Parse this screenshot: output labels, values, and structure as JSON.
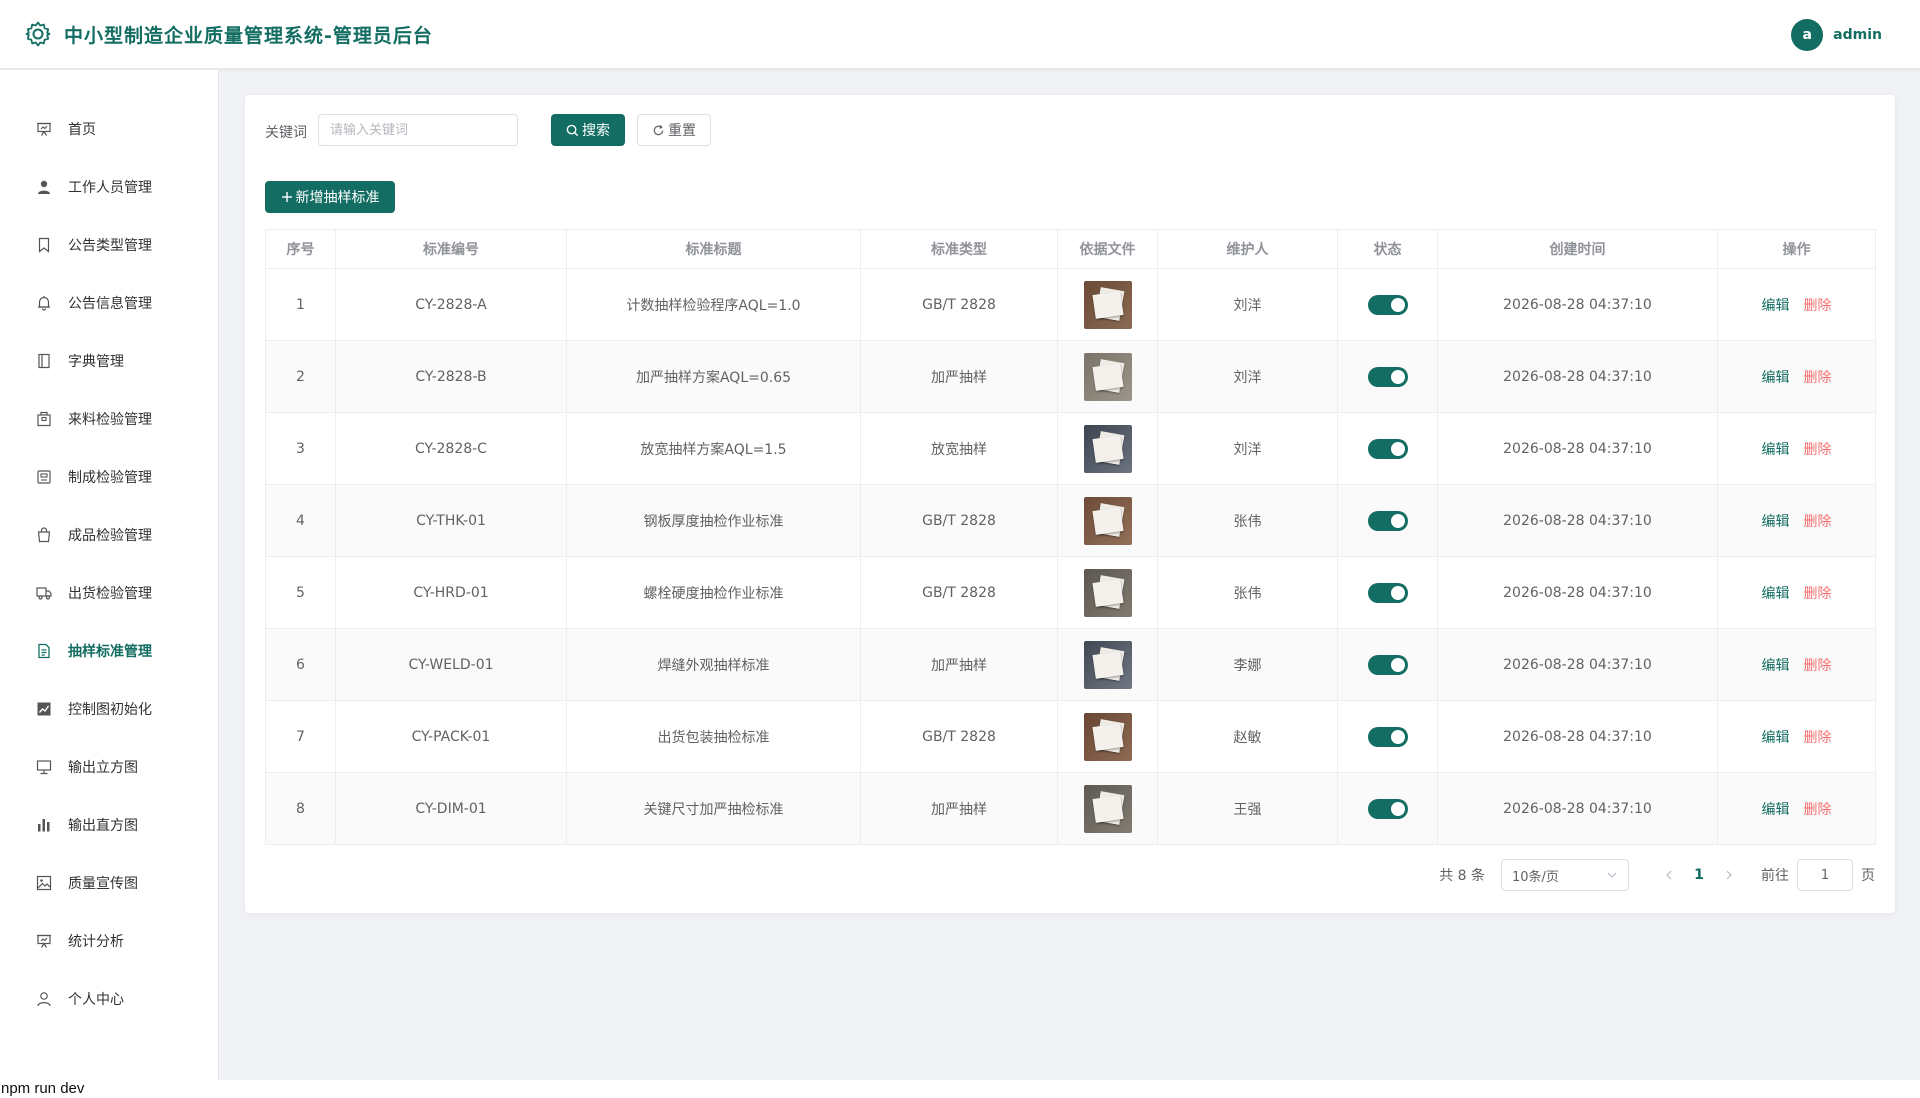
{
  "header": {
    "title": "中小型制造企业质量管理系统-管理员后台",
    "avatar_letter": "a",
    "username": "admin"
  },
  "sidebar": {
    "active": "抽样标准管理",
    "items": [
      {
        "label": "首页",
        "icon": "presentation-icon"
      },
      {
        "label": "工作人员管理",
        "icon": "user-filled-icon"
      },
      {
        "label": "公告类型管理",
        "icon": "bookmark-icon"
      },
      {
        "label": "公告信息管理",
        "icon": "bell-icon"
      },
      {
        "label": "字典管理",
        "icon": "notebook-icon"
      },
      {
        "label": "来料检验管理",
        "icon": "box-icon"
      },
      {
        "label": "制成检验管理",
        "icon": "suitcase-icon"
      },
      {
        "label": "成品检验管理",
        "icon": "handbag-icon"
      },
      {
        "label": "出货检验管理",
        "icon": "truck-icon"
      },
      {
        "label": "抽样标准管理",
        "icon": "document-icon"
      },
      {
        "label": "控制图初始化",
        "icon": "line-chart-icon"
      },
      {
        "label": "输出立方图",
        "icon": "monitor-icon"
      },
      {
        "label": "输出直方图",
        "icon": "bar-chart-icon"
      },
      {
        "label": "质量宣传图",
        "icon": "picture-icon"
      },
      {
        "label": "统计分析",
        "icon": "presentation-icon"
      },
      {
        "label": "个人中心",
        "icon": "user-icon"
      }
    ]
  },
  "search": {
    "label": "关键词",
    "placeholder": "请输入关键词",
    "value": "",
    "search_btn": "搜索",
    "reset_btn": "重置",
    "add_btn": "新增抽样标准"
  },
  "table": {
    "headers": [
      "序号",
      "标准编号",
      "标准标题",
      "标准类型",
      "依据文件",
      "维护人",
      "状态",
      "创建时间",
      "操作"
    ],
    "edit_label": "编辑",
    "delete_label": "删除",
    "rows": [
      {
        "no": "1",
        "code": "CY-2828-A",
        "title": "计数抽样检验程序AQL=1.0",
        "type": "GB/T 2828",
        "maintainer": "刘洋",
        "status": true,
        "created": "2026-08-28 04:37:10"
      },
      {
        "no": "2",
        "code": "CY-2828-B",
        "title": "加严抽样方案AQL=0.65",
        "type": "加严抽样",
        "maintainer": "刘洋",
        "status": true,
        "created": "2026-08-28 04:37:10"
      },
      {
        "no": "3",
        "code": "CY-2828-C",
        "title": "放宽抽样方案AQL=1.5",
        "type": "放宽抽样",
        "maintainer": "刘洋",
        "status": true,
        "created": "2026-08-28 04:37:10"
      },
      {
        "no": "4",
        "code": "CY-THK-01",
        "title": "钢板厚度抽检作业标准",
        "type": "GB/T 2828",
        "maintainer": "张伟",
        "status": true,
        "created": "2026-08-28 04:37:10"
      },
      {
        "no": "5",
        "code": "CY-HRD-01",
        "title": "螺栓硬度抽检作业标准",
        "type": "GB/T 2828",
        "maintainer": "张伟",
        "status": true,
        "created": "2026-08-28 04:37:10"
      },
      {
        "no": "6",
        "code": "CY-WELD-01",
        "title": "焊缝外观抽样标准",
        "type": "加严抽样",
        "maintainer": "李娜",
        "status": true,
        "created": "2026-08-28 04:37:10"
      },
      {
        "no": "7",
        "code": "CY-PACK-01",
        "title": "出货包装抽检标准",
        "type": "GB/T 2828",
        "maintainer": "赵敏",
        "status": true,
        "created": "2026-08-28 04:37:10"
      },
      {
        "no": "8",
        "code": "CY-DIM-01",
        "title": "关键尺寸加严抽检标准",
        "type": "加严抽样",
        "maintainer": "王强",
        "status": true,
        "created": "2026-08-28 04:37:10"
      }
    ]
  },
  "pagination": {
    "total": "共 8 条",
    "page_size": "10条/页",
    "current_page": "1",
    "goto_label": "前往",
    "goto_value": "1",
    "page_suffix": "页"
  },
  "terminal": "npm run dev",
  "colors": {
    "accent": "#136d62",
    "danger": "#f56c6c"
  }
}
